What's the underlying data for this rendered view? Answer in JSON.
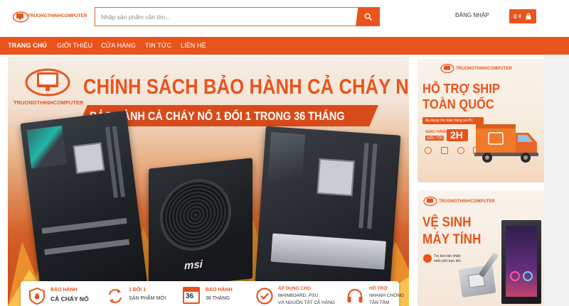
{
  "header": {
    "logo_text": "TRUONGTHINHCOMPUTER",
    "search_placeholder": "Nhập sản phẩm cần tìm...",
    "login_label": "ĐĂNG NHẬP",
    "cart_total": "0 ₫"
  },
  "nav": {
    "items": [
      "TRANG CHỦ",
      "GIỚI THIỆU",
      "CỬA HÀNG",
      "TIN TỨC",
      "LIÊN HỆ"
    ]
  },
  "banner_main": {
    "logo_text": "TRUONGTHINHCOMPUTER",
    "title": "CHÍNH SÁCH BẢO HÀNH CẢ CHÁY NỔ",
    "subtitle": "BẢO HÀNH CẢ CHÁY NỔ 1 ĐỔI 1 TRONG 36 THÁNG",
    "psu_brand": "msi",
    "features": [
      {
        "icon": "shield-fire-icon",
        "line1": "BẢO HÀNH",
        "line2": "CẢ CHÁY NỔ"
      },
      {
        "icon": "exchange-icon",
        "line1": "1 ĐỔI 1",
        "line2": "SẢN PHẨM MỚI"
      },
      {
        "icon": "calendar-icon",
        "badge": "36",
        "line1": "BẢO HÀNH",
        "line2": "36 THÁNG"
      },
      {
        "icon": "check-badge-icon",
        "line1": "ÁP DỤNG CHO",
        "line2": "MAINBOARD, PSU",
        "line3": "VÀ NGUỒN TẤT CẢ HÃNG"
      },
      {
        "icon": "headset-icon",
        "line1": "HỖ TRỢ",
        "line2": "NHANH CHÓNG",
        "line3": "TẬN TÂM"
      }
    ]
  },
  "side_banner_1": {
    "logo_text": "TRUONGTHINHCOMPUTER",
    "title_line1": "HỖ TRỢ SHIP",
    "title_line2": "TOÀN QUỐC",
    "note": "Áp dụng cho toàn hàng và PC",
    "delivery_label_1": "GIAO HÀNG",
    "delivery_label_2": "SIÊU TỐC",
    "delivery_time": "2H"
  },
  "side_banner_2": {
    "logo_text": "TRUONGTHINHCOMPUTER",
    "title_line1": "VỆ SINH",
    "title_line2": "MÁY TÍNH",
    "note_1": "Tra keo tản nhiệt",
    "note_2": "miễn phí trọn đời"
  },
  "colors": {
    "brand": "#e8541c",
    "brand_dark": "#c8401a",
    "fire": "#f28a2a"
  }
}
